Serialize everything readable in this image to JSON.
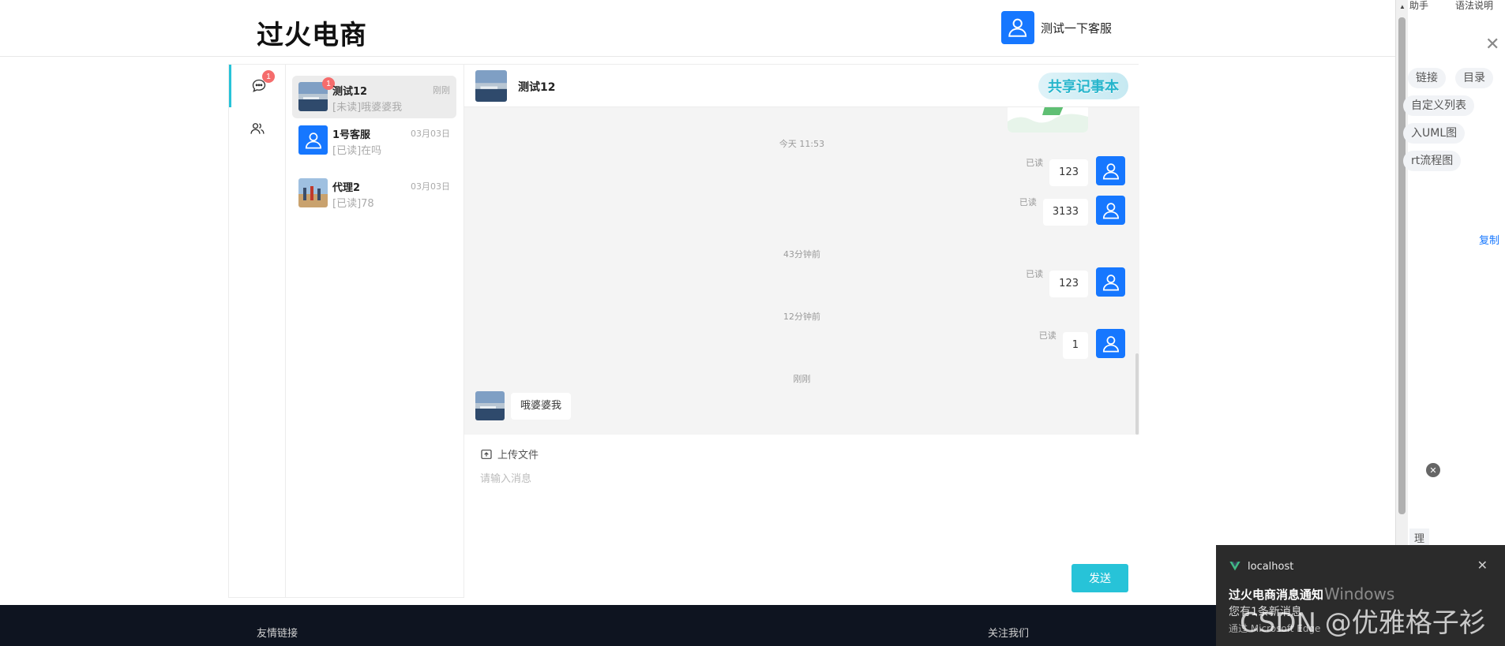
{
  "header": {
    "brand": "过火电商",
    "service_name": "测试一下客服"
  },
  "rail": {
    "chat_badge": "1"
  },
  "conversations": [
    {
      "name": "测试12",
      "preview": "[未读]哦婆婆我",
      "time": "刚刚",
      "badge": "1"
    },
    {
      "name": "1号客服",
      "preview": "[已读]在吗",
      "time": "03月03日"
    },
    {
      "name": "代理2",
      "preview": "[已读]78",
      "time": "03月03日"
    }
  ],
  "chat": {
    "title": "测试12",
    "note_button": "共享记事本",
    "timestamps": [
      "今天 11:53",
      "43分钟前",
      "12分钟前",
      "刚刚"
    ],
    "messages": [
      {
        "read": "已读",
        "text": "123"
      },
      {
        "read": "已读",
        "text": "3133"
      },
      {
        "read": "已读",
        "text": "123"
      },
      {
        "read": "已读",
        "text": "1"
      }
    ],
    "incoming": "哦婆婆我",
    "upload_label": "上传文件",
    "input_placeholder": "请输入消息",
    "send_label": "发送"
  },
  "footer": {
    "links_title": "友情链接",
    "follow_title": "关注我们"
  },
  "side_panel": {
    "top_left": "助手",
    "top_right": "语法说明",
    "chips": [
      "链接",
      "目录",
      "自定义列表",
      "入UML图",
      "rt流程图"
    ],
    "copy": "复制",
    "tail": "理"
  },
  "toast": {
    "app": "localhost",
    "title": "过火电商消息通知",
    "body": "您有1条新消息",
    "via": "通过 Microsoft Edge"
  },
  "watermarks": {
    "windows": "Windows",
    "csdn": "CSDN @优雅格子衫"
  },
  "colors": {
    "accent": "#27c3d8",
    "avatar_blue": "#1677ff",
    "badge_red": "#f56c6c"
  }
}
